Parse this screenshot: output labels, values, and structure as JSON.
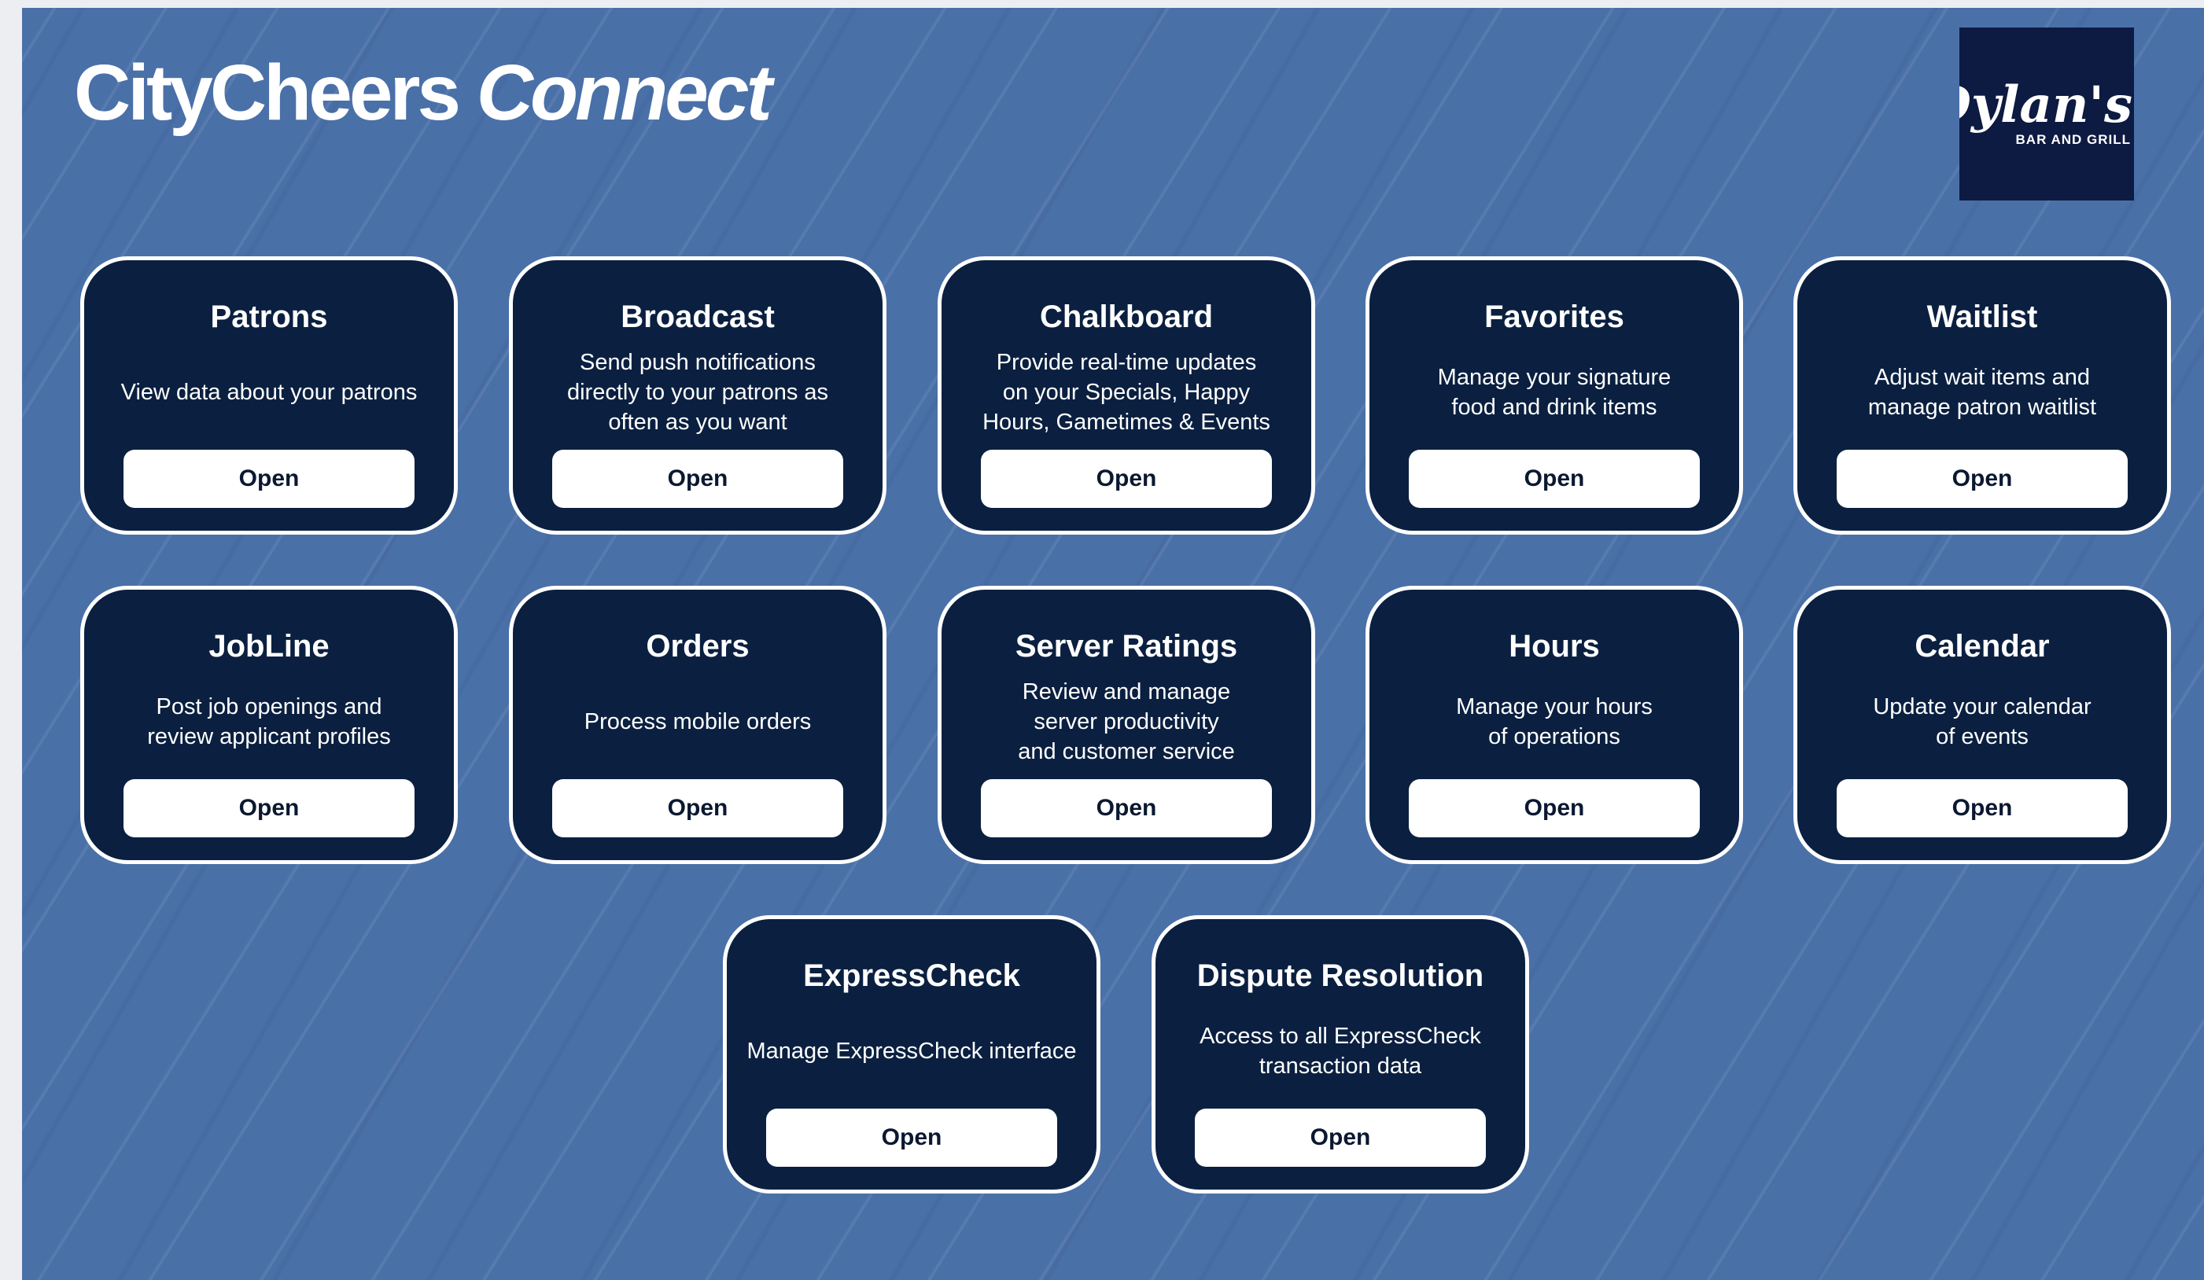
{
  "header": {
    "title_brand": "CityCheers",
    "title_suffix": " Connect"
  },
  "logo": {
    "script_text": "Dylan's",
    "sub_text": "BAR AND GRILL"
  },
  "colors": {
    "background": "#4a70a8",
    "card": "#0b2040",
    "card_border": "#ffffff",
    "button": "#ffffff",
    "button_text": "#0b1830",
    "logo_bg": "#0d1a42"
  },
  "cards": [
    {
      "title": "Patrons",
      "description": "View data about your patrons",
      "button": "Open"
    },
    {
      "title": "Broadcast",
      "description": "Send push notifications\ndirectly to your patrons as\noften as you want",
      "button": "Open"
    },
    {
      "title": "Chalkboard",
      "description": "Provide real-time updates\non your Specials, Happy\nHours, Gametimes & Events",
      "button": "Open"
    },
    {
      "title": "Favorites",
      "description": "Manage your signature\nfood and drink items",
      "button": "Open"
    },
    {
      "title": "Waitlist",
      "description": "Adjust wait items and\nmanage patron waitlist",
      "button": "Open"
    },
    {
      "title": "JobLine",
      "description": "Post job openings and\nreview applicant profiles",
      "button": "Open"
    },
    {
      "title": "Orders",
      "description": "Process mobile orders",
      "button": "Open"
    },
    {
      "title": "Server Ratings",
      "description": "Review and manage\nserver productivity\nand customer service",
      "button": "Open"
    },
    {
      "title": "Hours",
      "description": "Manage your hours\nof operations",
      "button": "Open"
    },
    {
      "title": "Calendar",
      "description": "Update your calendar\nof events",
      "button": "Open"
    },
    {
      "title": "ExpressCheck",
      "description": "Manage ExpressCheck interface",
      "button": "Open"
    },
    {
      "title": "Dispute Resolution",
      "description": "Access to all ExpressCheck\ntransaction data",
      "button": "Open"
    }
  ]
}
